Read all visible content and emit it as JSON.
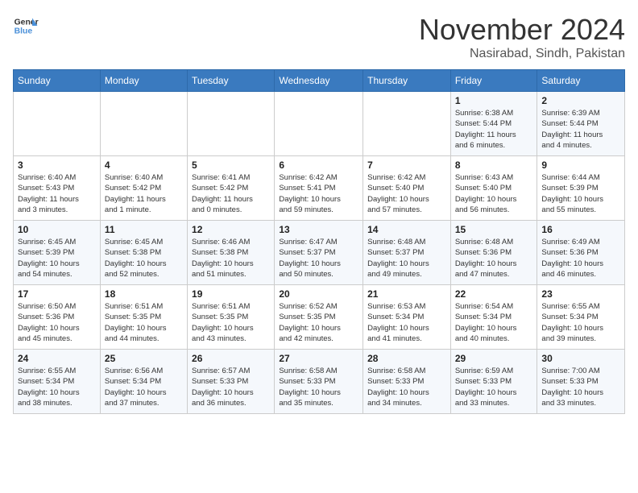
{
  "header": {
    "logo_line1": "General",
    "logo_line2": "Blue",
    "month_title": "November 2024",
    "location": "Nasirabad, Sindh, Pakistan"
  },
  "weekdays": [
    "Sunday",
    "Monday",
    "Tuesday",
    "Wednesday",
    "Thursday",
    "Friday",
    "Saturday"
  ],
  "weeks": [
    [
      {
        "day": "",
        "info": ""
      },
      {
        "day": "",
        "info": ""
      },
      {
        "day": "",
        "info": ""
      },
      {
        "day": "",
        "info": ""
      },
      {
        "day": "",
        "info": ""
      },
      {
        "day": "1",
        "info": "Sunrise: 6:38 AM\nSunset: 5:44 PM\nDaylight: 11 hours\nand 6 minutes."
      },
      {
        "day": "2",
        "info": "Sunrise: 6:39 AM\nSunset: 5:44 PM\nDaylight: 11 hours\nand 4 minutes."
      }
    ],
    [
      {
        "day": "3",
        "info": "Sunrise: 6:40 AM\nSunset: 5:43 PM\nDaylight: 11 hours\nand 3 minutes."
      },
      {
        "day": "4",
        "info": "Sunrise: 6:40 AM\nSunset: 5:42 PM\nDaylight: 11 hours\nand 1 minute."
      },
      {
        "day": "5",
        "info": "Sunrise: 6:41 AM\nSunset: 5:42 PM\nDaylight: 11 hours\nand 0 minutes."
      },
      {
        "day": "6",
        "info": "Sunrise: 6:42 AM\nSunset: 5:41 PM\nDaylight: 10 hours\nand 59 minutes."
      },
      {
        "day": "7",
        "info": "Sunrise: 6:42 AM\nSunset: 5:40 PM\nDaylight: 10 hours\nand 57 minutes."
      },
      {
        "day": "8",
        "info": "Sunrise: 6:43 AM\nSunset: 5:40 PM\nDaylight: 10 hours\nand 56 minutes."
      },
      {
        "day": "9",
        "info": "Sunrise: 6:44 AM\nSunset: 5:39 PM\nDaylight: 10 hours\nand 55 minutes."
      }
    ],
    [
      {
        "day": "10",
        "info": "Sunrise: 6:45 AM\nSunset: 5:39 PM\nDaylight: 10 hours\nand 54 minutes."
      },
      {
        "day": "11",
        "info": "Sunrise: 6:45 AM\nSunset: 5:38 PM\nDaylight: 10 hours\nand 52 minutes."
      },
      {
        "day": "12",
        "info": "Sunrise: 6:46 AM\nSunset: 5:38 PM\nDaylight: 10 hours\nand 51 minutes."
      },
      {
        "day": "13",
        "info": "Sunrise: 6:47 AM\nSunset: 5:37 PM\nDaylight: 10 hours\nand 50 minutes."
      },
      {
        "day": "14",
        "info": "Sunrise: 6:48 AM\nSunset: 5:37 PM\nDaylight: 10 hours\nand 49 minutes."
      },
      {
        "day": "15",
        "info": "Sunrise: 6:48 AM\nSunset: 5:36 PM\nDaylight: 10 hours\nand 47 minutes."
      },
      {
        "day": "16",
        "info": "Sunrise: 6:49 AM\nSunset: 5:36 PM\nDaylight: 10 hours\nand 46 minutes."
      }
    ],
    [
      {
        "day": "17",
        "info": "Sunrise: 6:50 AM\nSunset: 5:36 PM\nDaylight: 10 hours\nand 45 minutes."
      },
      {
        "day": "18",
        "info": "Sunrise: 6:51 AM\nSunset: 5:35 PM\nDaylight: 10 hours\nand 44 minutes."
      },
      {
        "day": "19",
        "info": "Sunrise: 6:51 AM\nSunset: 5:35 PM\nDaylight: 10 hours\nand 43 minutes."
      },
      {
        "day": "20",
        "info": "Sunrise: 6:52 AM\nSunset: 5:35 PM\nDaylight: 10 hours\nand 42 minutes."
      },
      {
        "day": "21",
        "info": "Sunrise: 6:53 AM\nSunset: 5:34 PM\nDaylight: 10 hours\nand 41 minutes."
      },
      {
        "day": "22",
        "info": "Sunrise: 6:54 AM\nSunset: 5:34 PM\nDaylight: 10 hours\nand 40 minutes."
      },
      {
        "day": "23",
        "info": "Sunrise: 6:55 AM\nSunset: 5:34 PM\nDaylight: 10 hours\nand 39 minutes."
      }
    ],
    [
      {
        "day": "24",
        "info": "Sunrise: 6:55 AM\nSunset: 5:34 PM\nDaylight: 10 hours\nand 38 minutes."
      },
      {
        "day": "25",
        "info": "Sunrise: 6:56 AM\nSunset: 5:34 PM\nDaylight: 10 hours\nand 37 minutes."
      },
      {
        "day": "26",
        "info": "Sunrise: 6:57 AM\nSunset: 5:33 PM\nDaylight: 10 hours\nand 36 minutes."
      },
      {
        "day": "27",
        "info": "Sunrise: 6:58 AM\nSunset: 5:33 PM\nDaylight: 10 hours\nand 35 minutes."
      },
      {
        "day": "28",
        "info": "Sunrise: 6:58 AM\nSunset: 5:33 PM\nDaylight: 10 hours\nand 34 minutes."
      },
      {
        "day": "29",
        "info": "Sunrise: 6:59 AM\nSunset: 5:33 PM\nDaylight: 10 hours\nand 33 minutes."
      },
      {
        "day": "30",
        "info": "Sunrise: 7:00 AM\nSunset: 5:33 PM\nDaylight: 10 hours\nand 33 minutes."
      }
    ]
  ]
}
